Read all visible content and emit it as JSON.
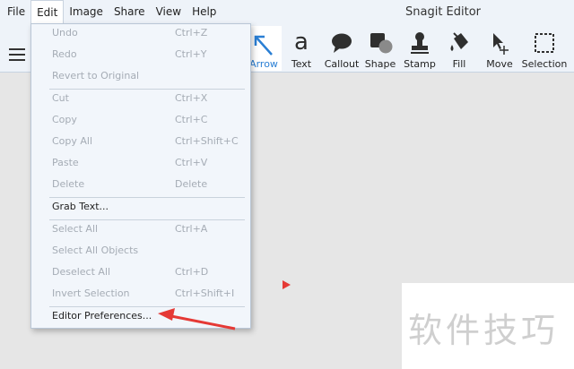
{
  "window": {
    "title": "Snagit Editor"
  },
  "menubar": {
    "items": [
      {
        "label": "File"
      },
      {
        "label": "Edit"
      },
      {
        "label": "Image"
      },
      {
        "label": "Share"
      },
      {
        "label": "View"
      },
      {
        "label": "Help"
      }
    ]
  },
  "toolbar": {
    "tools": [
      {
        "label": "Arrow",
        "icon": "arrow-tool-icon"
      },
      {
        "label": "Text",
        "icon": "text-tool-icon"
      },
      {
        "label": "Callout",
        "icon": "callout-tool-icon"
      },
      {
        "label": "Shape",
        "icon": "shape-tool-icon"
      },
      {
        "label": "Stamp",
        "icon": "stamp-tool-icon"
      },
      {
        "label": "Fill",
        "icon": "fill-tool-icon"
      },
      {
        "label": "Move",
        "icon": "move-tool-icon"
      },
      {
        "label": "Selection",
        "icon": "selection-tool-icon"
      }
    ],
    "text_glyph": "a"
  },
  "edit_menu": {
    "items": [
      {
        "label": "Undo",
        "shortcut": "Ctrl+Z",
        "enabled": false
      },
      {
        "label": "Redo",
        "shortcut": "Ctrl+Y",
        "enabled": false
      },
      {
        "label": "Revert to Original",
        "shortcut": "",
        "enabled": false
      },
      {
        "label": "Cut",
        "shortcut": "Ctrl+X",
        "enabled": false
      },
      {
        "label": "Copy",
        "shortcut": "Ctrl+C",
        "enabled": false
      },
      {
        "label": "Copy All",
        "shortcut": "Ctrl+Shift+C",
        "enabled": false
      },
      {
        "label": "Paste",
        "shortcut": "Ctrl+V",
        "enabled": false
      },
      {
        "label": "Delete",
        "shortcut": "Delete",
        "enabled": false
      },
      {
        "label": "Grab Text...",
        "shortcut": "",
        "enabled": true
      },
      {
        "label": "Select All",
        "shortcut": "Ctrl+A",
        "enabled": false
      },
      {
        "label": "Select All Objects",
        "shortcut": "",
        "enabled": false
      },
      {
        "label": "Deselect All",
        "shortcut": "Ctrl+D",
        "enabled": false
      },
      {
        "label": "Invert Selection",
        "shortcut": "Ctrl+Shift+I",
        "enabled": false
      },
      {
        "label": "Editor Preferences...",
        "shortcut": "",
        "enabled": true
      }
    ]
  },
  "watermark": {
    "text": "软件技巧"
  },
  "colors": {
    "accent": "#2a7fd4",
    "annotation_red": "#e53935",
    "menu_bg": "#f2f6fb"
  }
}
